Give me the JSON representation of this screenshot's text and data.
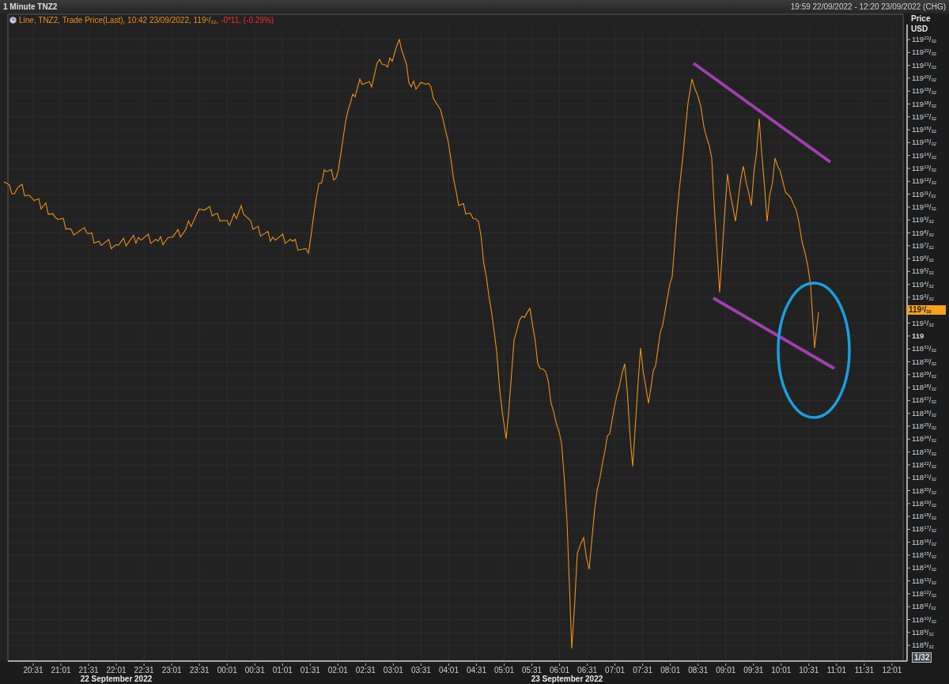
{
  "title": "1 Minute TNZ2",
  "range": "19:59 22/09/2022 - 12:20 23/09/2022 (CHG)",
  "legend": {
    "text": "Line, TNZ2, Trade Price(Last),  10:42 23/09/2022, 119$^{2}$/$_{32}$,",
    "change": "-0*11, (-0.29%)"
  },
  "axis_header": [
    "Price",
    "USD"
  ],
  "last_price": {
    "label": "119$^{2}$/$_{32}$"
  },
  "scale_label": "1/32",
  "date_labels": [
    "22 September 2022",
    "23 September 2022"
  ],
  "overlays": [
    {
      "kind": "trend_line",
      "color": "#a040b0"
    },
    {
      "kind": "trend_line",
      "color": "#a040b0"
    },
    {
      "kind": "ellipse",
      "color": "#1a9fe0"
    }
  ],
  "chart": {
    "x_labels": [
      "20:31",
      "21:01",
      "21:31",
      "22:01",
      "22:31",
      "23:01",
      "23:31",
      "00:01",
      "00:31",
      "01:01",
      "01:31",
      "02:01",
      "02:31",
      "03:01",
      "03:31",
      "04:01",
      "04:31",
      "05:01",
      "05:31",
      "06:01",
      "06:31",
      "07:01",
      "07:31",
      "08:01",
      "08:31",
      "09:01",
      "09:31",
      "10:01",
      "10:31",
      "11:01",
      "11:31",
      "12:01"
    ],
    "y_labels": [
      "119$^{23}$/$_{32}$",
      "119$^{22}$/$_{32}$",
      "119$^{21}$/$_{32}$",
      "119$^{20}$/$_{32}$",
      "119$^{19}$/$_{32}$",
      "119$^{18}$/$_{32}$",
      "119$^{17}$/$_{32}$",
      "119$^{16}$/$_{32}$",
      "119$^{15}$/$_{32}$",
      "119$^{14}$/$_{32}$",
      "119$^{13}$/$_{32}$",
      "119$^{12}$/$_{32}$",
      "119$^{11}$/$_{32}$",
      "119$^{10}$/$_{32}$",
      "119$^{9}$/$_{32}$",
      "119$^{8}$/$_{32}$",
      "119$^{7}$/$_{32}$",
      "119$^{6}$/$_{32}$",
      "119$^{5}$/$_{32}$",
      "119$^{4}$/$_{32}$",
      "119$^{3}$/$_{32}$",
      "119$^{1}$/$_{32}$",
      "119",
      "118$^{31}$/$_{32}$",
      "118$^{30}$/$_{32}$",
      "118$^{29}$/$_{32}$",
      "118$^{28}$/$_{32}$",
      "118$^{27}$/$_{32}$",
      "118$^{26}$/$_{32}$",
      "118$^{25}$/$_{32}$",
      "118$^{24}$/$_{32}$",
      "118$^{23}$/$_{32}$",
      "118$^{22}$/$_{32}$",
      "118$^{21}$/$_{32}$",
      "118$^{20}$/$_{32}$",
      "118$^{19}$/$_{32}$",
      "118$^{18}$/$_{32}$",
      "118$^{17}$/$_{32}$",
      "118$^{16}$/$_{32}$",
      "118$^{15}$/$_{32}$",
      "118$^{14}$/$_{32}$",
      "118$^{13}$/$_{32}$",
      "118$^{12}$/$_{32}$",
      "118$^{11}$/$_{32}$",
      "118$^{10}$/$_{32}$",
      "118$^{9}$/$_{32}$",
      "118$^{8}$/$_{32}$"
    ]
  }
}
